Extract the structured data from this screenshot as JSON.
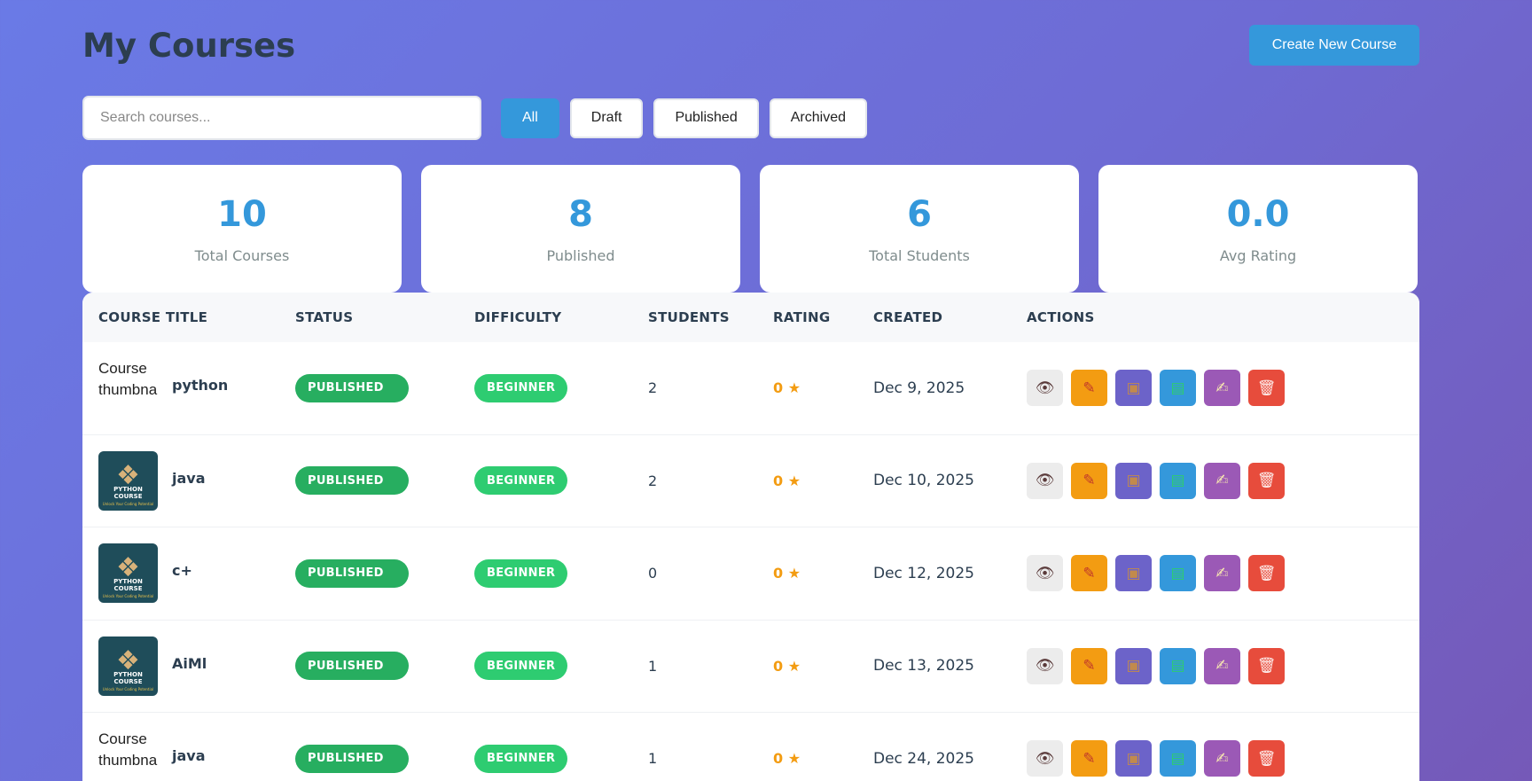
{
  "header": {
    "title": "My Courses",
    "create_label": "Create New Course"
  },
  "search": {
    "placeholder": "Search courses..."
  },
  "filters": [
    "All",
    "Draft",
    "Published",
    "Archived"
  ],
  "stats": [
    {
      "value": "10",
      "label": "Total Courses"
    },
    {
      "value": "8",
      "label": "Published"
    },
    {
      "value": "6",
      "label": "Total Students"
    },
    {
      "value": "0.0",
      "label": "Avg Rating"
    }
  ],
  "table": {
    "headers": [
      "COURSE TITLE",
      "STATUS",
      "DIFFICULTY",
      "STUDENTS",
      "RATING",
      "CREATED",
      "ACTIONS"
    ],
    "thumbnail_alt": "Course thumbnail",
    "thumbnail_caption": "PYTHON COURSE",
    "thumbnail_subcaption": "Unlock Your Coding Potential",
    "rows": [
      {
        "title": "python",
        "status": "PUBLISHED",
        "difficulty": "BEGINNER",
        "students": "2",
        "rating": "0 ★",
        "created": "Dec 9, 2025",
        "thumb": "broken"
      },
      {
        "title": "java",
        "status": "PUBLISHED",
        "difficulty": "BEGINNER",
        "students": "2",
        "rating": "0 ★",
        "created": "Dec 10, 2025",
        "thumb": "image"
      },
      {
        "title": "c+",
        "status": "PUBLISHED",
        "difficulty": "BEGINNER",
        "students": "0",
        "rating": "0 ★",
        "created": "Dec 12, 2025",
        "thumb": "image"
      },
      {
        "title": "AiMl",
        "status": "PUBLISHED",
        "difficulty": "BEGINNER",
        "students": "1",
        "rating": "0 ★",
        "created": "Dec 13, 2025",
        "thumb": "image"
      },
      {
        "title": "java",
        "status": "PUBLISHED",
        "difficulty": "BEGINNER",
        "students": "1",
        "rating": "0 ★",
        "created": "Dec 24, 2025",
        "thumb": "broken"
      }
    ]
  },
  "actions": [
    {
      "name": "view",
      "icon": "eye-icon",
      "glyph": "👁"
    },
    {
      "name": "edit",
      "icon": "pencil-icon",
      "glyph": "✎"
    },
    {
      "name": "pkg",
      "icon": "package-icon",
      "glyph": "▣"
    },
    {
      "name": "lessons",
      "icon": "books-icon",
      "glyph": "▤"
    },
    {
      "name": "quiz",
      "icon": "memo-icon",
      "glyph": "✍"
    },
    {
      "name": "del",
      "icon": "trash-icon",
      "glyph": "🗑"
    }
  ],
  "colors": {
    "primary": "#3498db",
    "published": "#27ae60",
    "beginner": "#2ecc71",
    "rating": "#f39c12"
  }
}
